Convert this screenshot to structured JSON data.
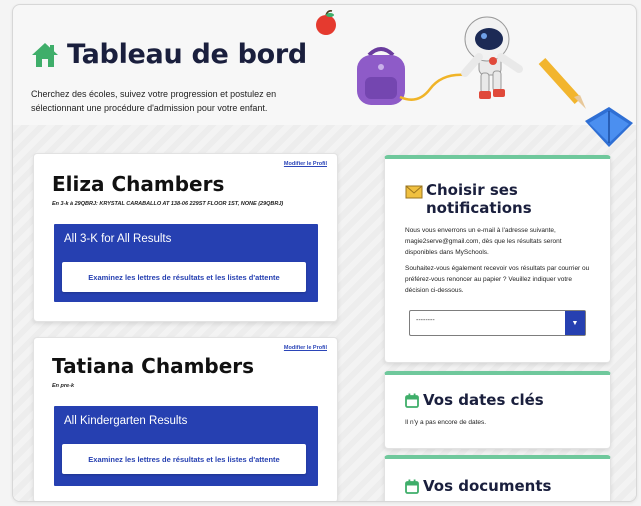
{
  "page": {
    "title": "Tableau de bord",
    "subtitle": "Cherchez des écoles, suivez votre progression et postulez en sélectionnant une procédure d'admission pour votre enfant."
  },
  "students": [
    {
      "name": "Eliza Chambers",
      "details": "En 3-k à 29QBRJ: KRYSTAL CARABALLO AT 138-06 229ST FLOOR 1ST, NONE (29QBRJ)",
      "profile_link": "Modifier le Profil",
      "results_title": "All 3-K for All Results",
      "results_button": "Examinez les lettres de résultats et les listes d'attente"
    },
    {
      "name": "Tatiana Chambers",
      "details": "En pre-k",
      "profile_link": "Modifier le Profil",
      "results_title": "All Kindergarten Results",
      "results_button": "Examinez les lettres de résultats et les listes d'attente"
    }
  ],
  "notifications": {
    "title": "Choisir ses notifications",
    "text1": "Nous vous enverrons un e-mail à l'adresse suivante, magie2serve@gmail.com, dès que les résultats seront disponibles dans MySchools.",
    "text2": "Souhaitez-vous également recevoir vos résultats par courrier ou préférez-vous renoncer au papier ? Veuillez indiquer votre décision ci-dessous.",
    "select_value": "--------"
  },
  "key_dates": {
    "title": "Vos dates clés",
    "text": "Il n'y a pas encore de dates."
  },
  "documents": {
    "title": "Vos documents"
  },
  "colors": {
    "primary": "#2640b1",
    "accent": "#6fc89c",
    "home_icon": "#3fae6a",
    "heading": "#1a1f3d"
  },
  "icons": [
    "home-icon",
    "envelope-icon",
    "calendar-icon",
    "apple-icon",
    "backpack-icon",
    "astronaut-icon",
    "pencil-icon",
    "book-icon"
  ]
}
